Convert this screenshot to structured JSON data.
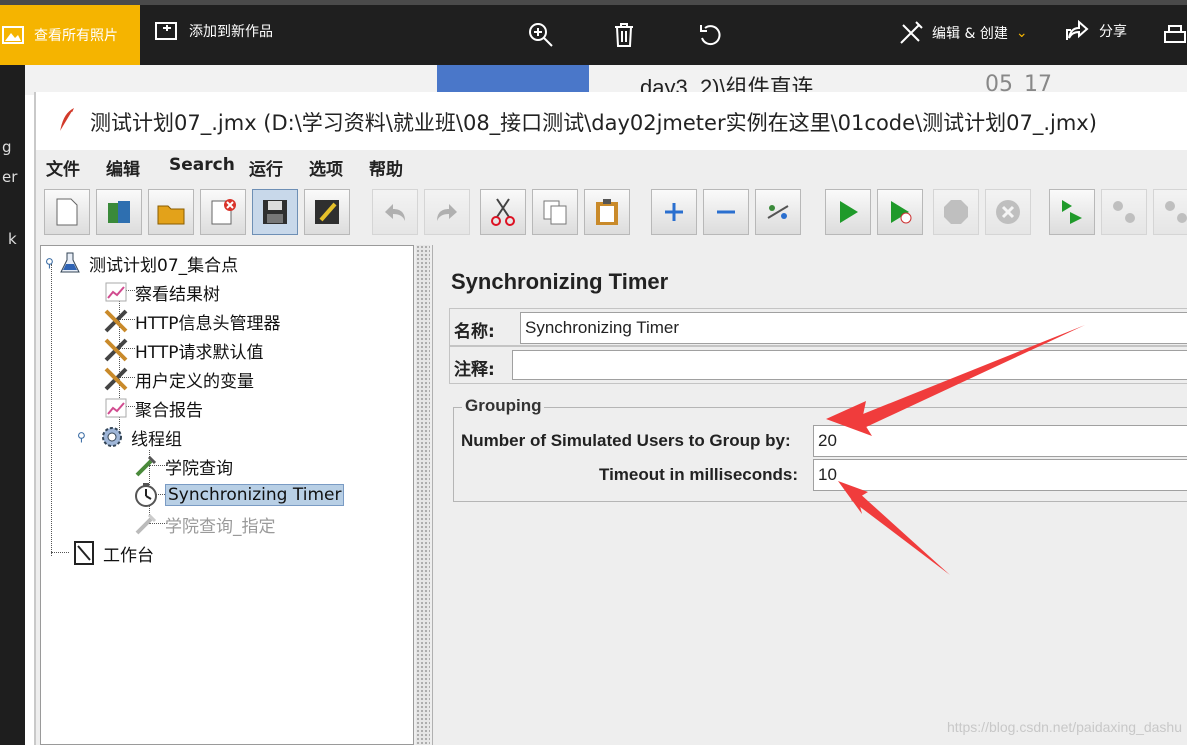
{
  "viewer": {
    "all_photos": "查看所有照片",
    "add_to_creation": "添加到新作品",
    "edit_create": "编辑 & 创建",
    "share": "分享",
    "icons": [
      "zoom-in-icon",
      "delete-icon",
      "rotate-icon",
      "edit-create-icon",
      "share-icon",
      "print-icon"
    ]
  },
  "background": {
    "item_text": "day3_2)\\组件直连",
    "item_date": "05_17",
    "left_fragments": [
      "g",
      "er",
      "k"
    ]
  },
  "window": {
    "title": "测试计划07_.jmx (D:\\学习资料\\就业班\\08_接口测试\\day02jmeter实例在这里\\01code\\测试计划07_.jmx)"
  },
  "menu": [
    "文件",
    "编辑",
    "Search",
    "运行",
    "选项",
    "帮助"
  ],
  "toolbar": [
    "new",
    "templates",
    "open",
    "close",
    "save",
    "save-as",
    "undo",
    "redo",
    "cut",
    "copy",
    "paste",
    "expand",
    "collapse",
    "toggle",
    "start",
    "start-no-pause",
    "stop",
    "shutdown",
    "remote-start",
    "remote-stop",
    "remote-clear"
  ],
  "tree": {
    "root": "测试计划07_集合点",
    "items": [
      {
        "label": "察看结果树"
      },
      {
        "label": "HTTP信息头管理器"
      },
      {
        "label": "HTTP请求默认值"
      },
      {
        "label": "用户定义的变量"
      },
      {
        "label": "聚合报告"
      },
      {
        "label": "线程组"
      },
      {
        "label": "学院查询"
      },
      {
        "label": "Synchronizing Timer"
      },
      {
        "label": "学院查询_指定"
      }
    ],
    "workbench": "工作台"
  },
  "panel": {
    "title": "Synchronizing Timer",
    "name_label": "名称:",
    "name_value": "Synchronizing Timer",
    "comment_label": "注释:",
    "comment_value": "",
    "group_legend": "Grouping",
    "users_label": "Number of Simulated Users to Group by:",
    "users_value": "20",
    "timeout_label": "Timeout in milliseconds:",
    "timeout_value": "10"
  },
  "watermark": "https://blog.csdn.net/paidaxing_dashu",
  "colors": {
    "accent": "#f5b400",
    "annotation": "#f03c3c",
    "selection": "#b8cfe5"
  }
}
